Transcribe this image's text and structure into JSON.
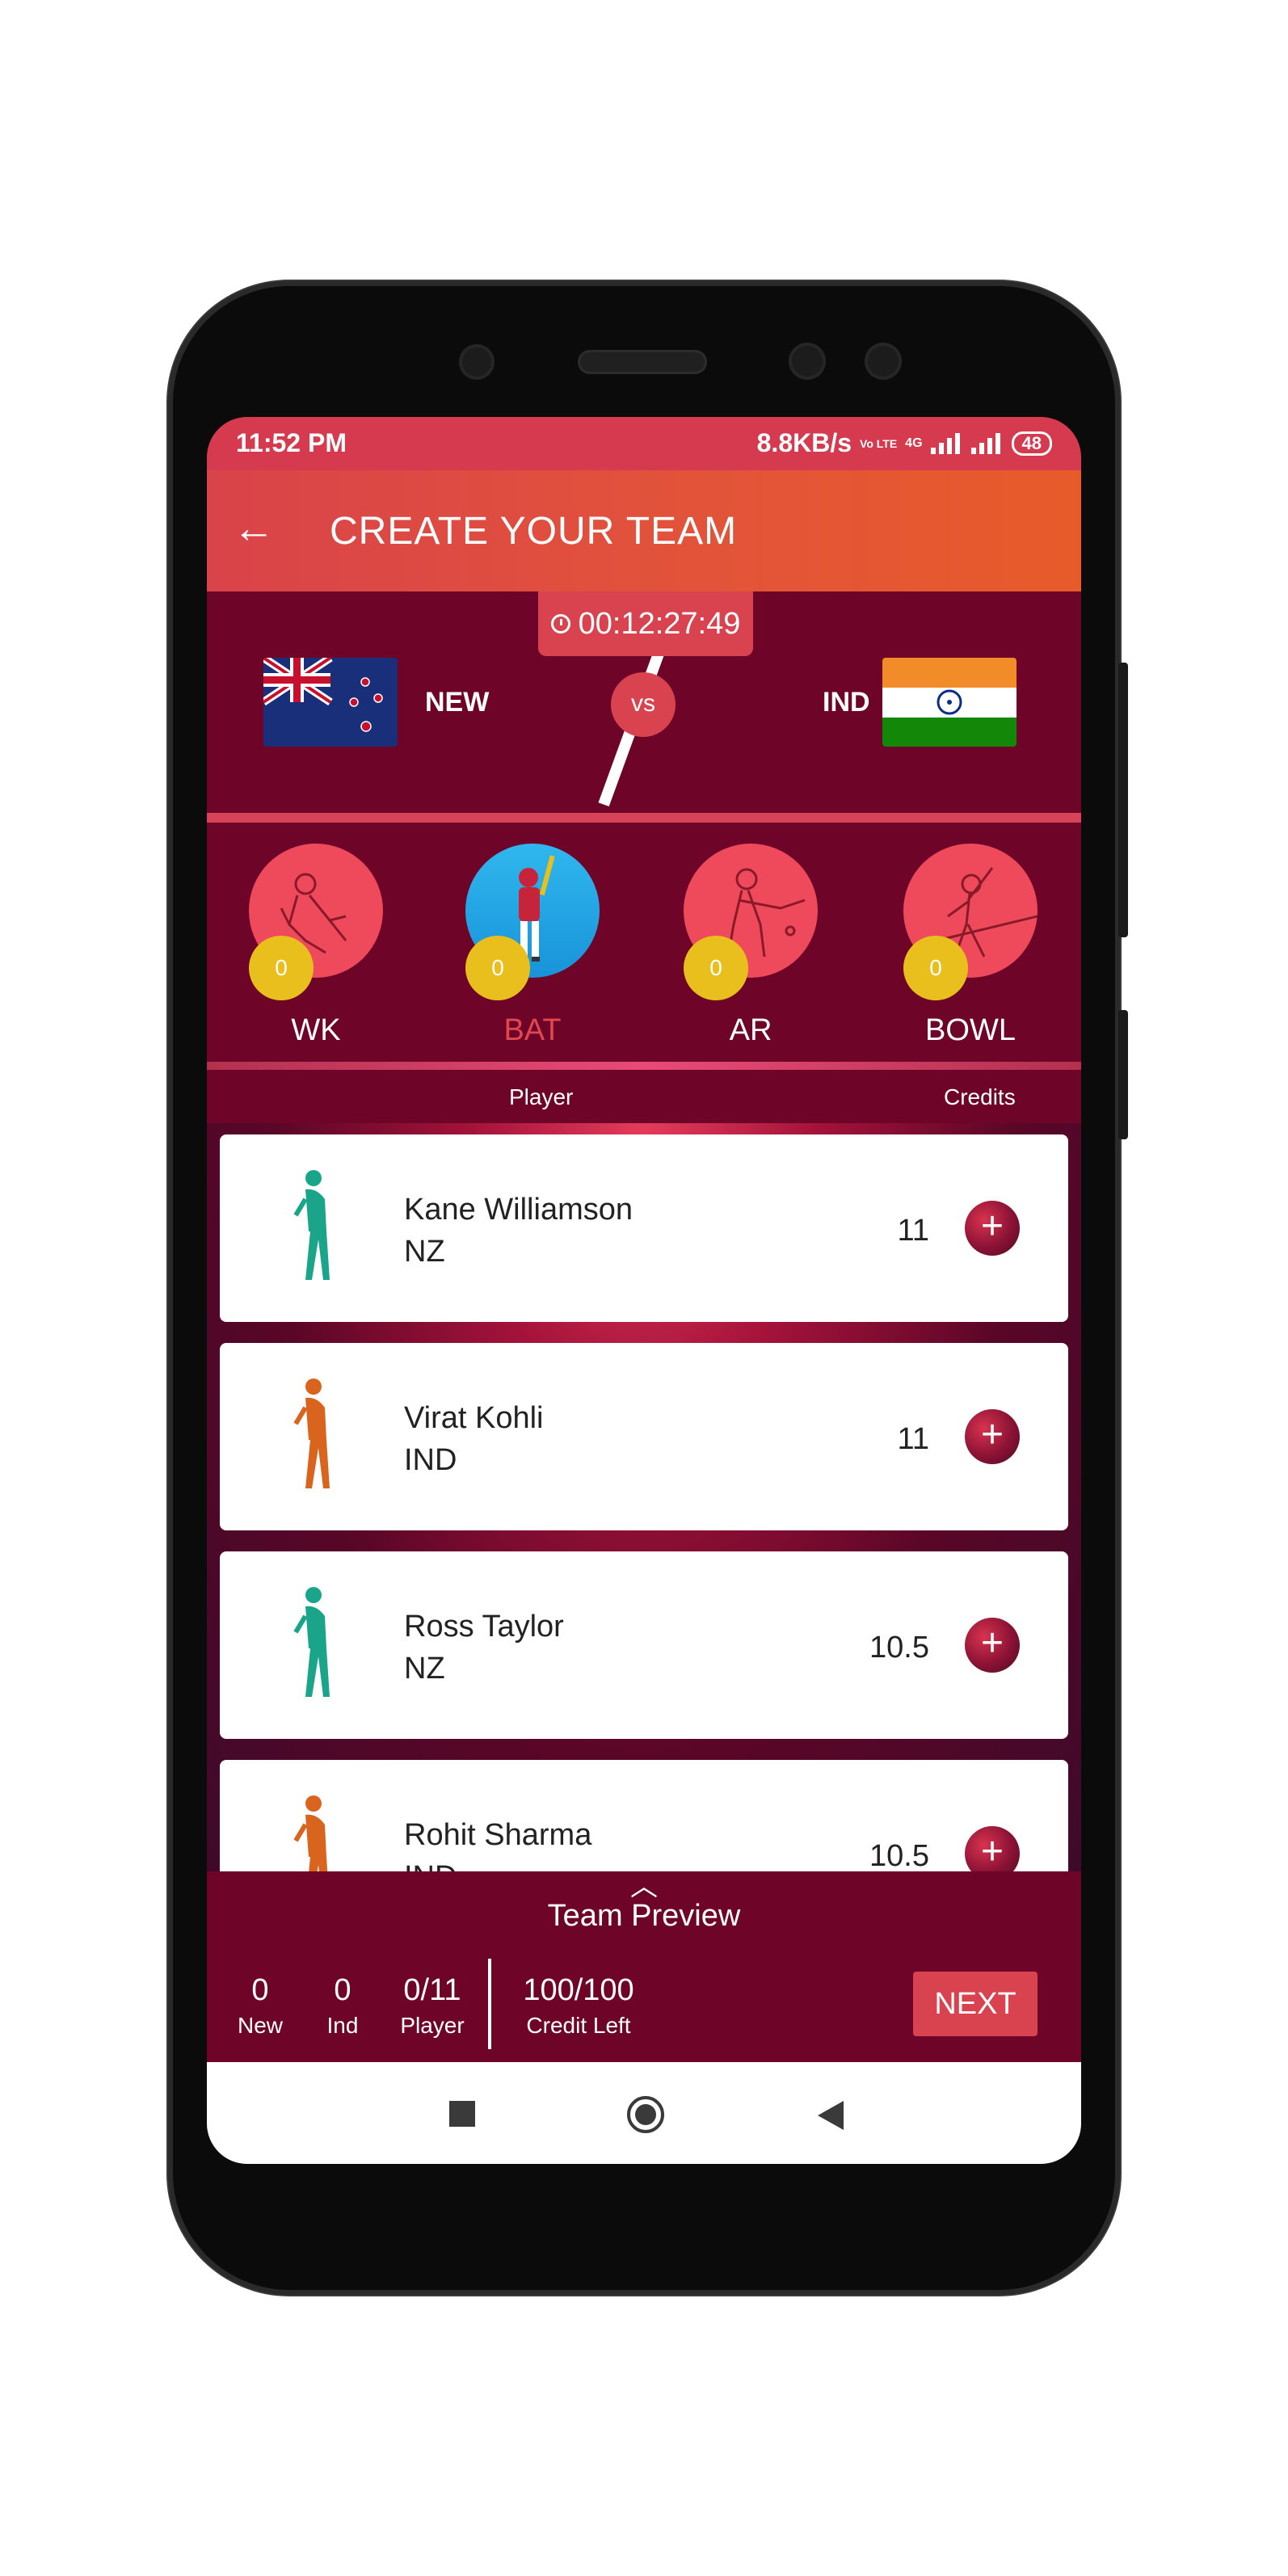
{
  "status_bar": {
    "time": "11:52 PM",
    "network_speed": "8.8KB/s",
    "volte_label": "Vo LTE",
    "network_type": "4G",
    "battery": "48"
  },
  "app_bar": {
    "back_icon": "arrow-left-icon",
    "title": "CREATE YOUR TEAM"
  },
  "match": {
    "timer": "00:12:27:49",
    "team1": {
      "short": "NEW",
      "flag": "new-zealand-flag"
    },
    "vs": "vs",
    "team2": {
      "short": "IND",
      "flag": "india-flag"
    }
  },
  "roles": [
    {
      "label": "WK",
      "count": "0",
      "active": false
    },
    {
      "label": "BAT",
      "count": "0",
      "active": true
    },
    {
      "label": "AR",
      "count": "0",
      "active": false
    },
    {
      "label": "BOWL",
      "count": "0",
      "active": false
    }
  ],
  "columns": {
    "player": "Player",
    "credits": "Credits"
  },
  "players": [
    {
      "name": "Kane Williamson",
      "team": "NZ",
      "credits": "11",
      "kit": "#1aa58a"
    },
    {
      "name": "Virat Kohli",
      "team": "IND",
      "credits": "11",
      "kit": "#d9641e"
    },
    {
      "name": "Ross Taylor",
      "team": "NZ",
      "credits": "10.5",
      "kit": "#1aa58a"
    },
    {
      "name": "Rohit Sharma",
      "team": "IND",
      "credits": "10.5",
      "kit": "#d9641e"
    }
  ],
  "footer": {
    "team_preview": "Team Preview",
    "stats": [
      {
        "value": "0",
        "label": "New"
      },
      {
        "value": "0",
        "label": "Ind"
      },
      {
        "value": "0/11",
        "label": "Player"
      },
      {
        "value": "100/100",
        "label": "Credit Left"
      }
    ],
    "next_label": "NEXT"
  },
  "colors": {
    "primary_dark": "#6e0428",
    "accent": "#d9434f",
    "appbar_gradient_end": "#e75b2a",
    "count_badge": "#e9bf1d",
    "active_role": "#30b7ee"
  }
}
